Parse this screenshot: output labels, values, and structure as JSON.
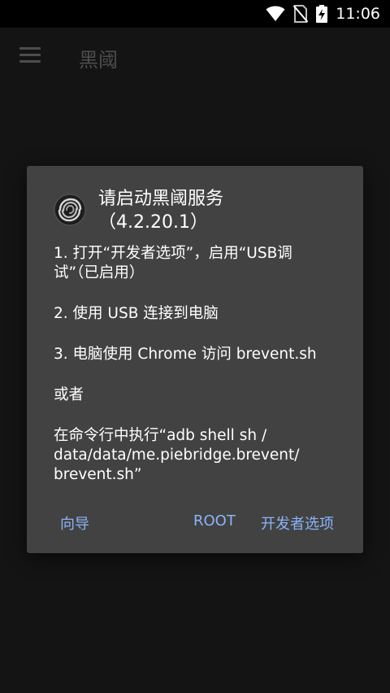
{
  "status_bar": {
    "time": "11:06",
    "icons": [
      "wifi-icon",
      "no-sim-icon",
      "battery-charging-icon"
    ]
  },
  "app_bar": {
    "title": "黑阈",
    "menu_icon": "menu-icon"
  },
  "dialog": {
    "icon": "brevent-logo-icon",
    "title_line1": "请启动黑阈服务",
    "title_line2": "（4.2.20.1）",
    "body": {
      "step1_line1": "1. 打开“开发者选项”，启用“USB调",
      "step1_line2": "试”（已启用）",
      "step2": "2. 使用 USB 连接到电脑",
      "step3": "3. 电脑使用 Chrome 访问 brevent.sh",
      "or": "或者",
      "cmd_line1": "在命令行中执行“adb shell sh /",
      "cmd_line2": "data/data/me.piebridge.brevent/",
      "cmd_line3": "brevent.sh”"
    },
    "actions": {
      "guide": "向导",
      "root": "ROOT",
      "developer_options": "开发者选项"
    }
  },
  "colors": {
    "background": "#141414",
    "dialog": "#424242",
    "accent": "#8ab4f8",
    "status_bar": "#000000"
  }
}
